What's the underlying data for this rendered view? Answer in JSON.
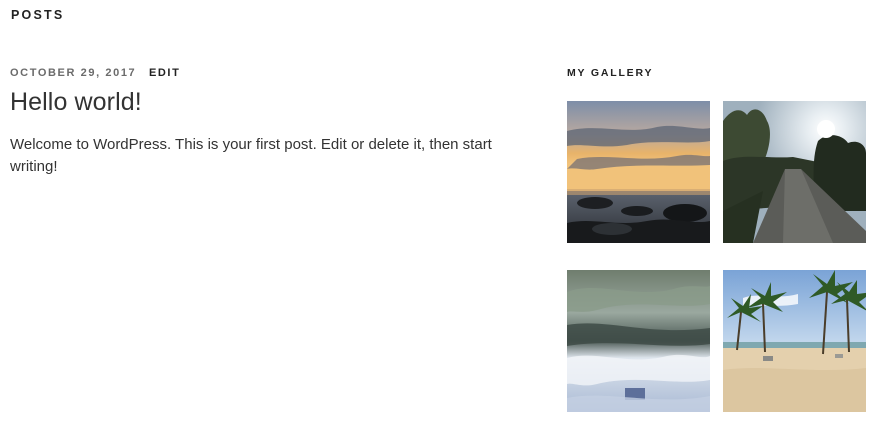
{
  "page": {
    "section_heading": "POSTS"
  },
  "post": {
    "date": "OCTOBER 29, 2017",
    "edit_label": "EDIT",
    "title": "Hello world!",
    "content": "Welcome to WordPress. This is your first post. Edit or delete it, then start writing!"
  },
  "sidebar": {
    "gallery_title": "MY GALLERY",
    "images": [
      {
        "subject": "sunset-over-rocky-sea"
      },
      {
        "subject": "tree-lined-path-at-sunrise"
      },
      {
        "subject": "water-and-clouds-abstract"
      },
      {
        "subject": "palm-trees-on-beach"
      }
    ]
  }
}
